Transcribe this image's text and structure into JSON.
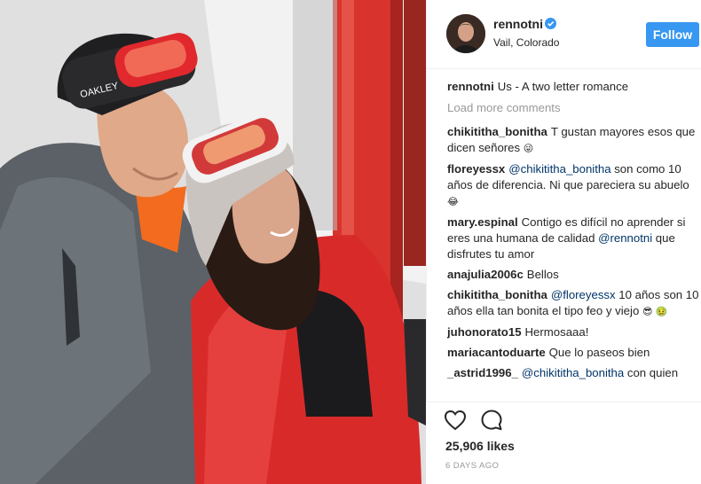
{
  "post": {
    "username": "rennotni",
    "location": "Vail, Colorado",
    "follow_label": "Follow",
    "caption": {
      "user": "rennotni",
      "text": "Us - A two letter romance"
    },
    "load_more_label": "Load more comments",
    "likes": "25,906 likes",
    "timestamp": "6 DAYS AGO"
  },
  "comments": [
    {
      "user": "chikititha_bonitha",
      "pre": "T gustan mayores esos que dicen señores",
      "mention": "",
      "post": "",
      "emoji": "😜"
    },
    {
      "user": "floreyessx",
      "pre": "",
      "mention": "@chikititha_bonitha",
      "post": " son como 10 años de diferencia. Ni que pareciera su abuelo",
      "emoji": "😂"
    },
    {
      "user": "mary.espinal",
      "pre": "Contigo es difícil no aprender si eres una humana de calidad ",
      "mention": "@rennotni",
      "post": " que disfrutes tu amor",
      "emoji": ""
    },
    {
      "user": "anajulia2006c",
      "pre": "Bellos",
      "mention": "",
      "post": "",
      "emoji": ""
    },
    {
      "user": "chikititha_bonitha",
      "pre": "",
      "mention": "@floreyessx",
      "post": " 10 años son 10 años ella tan bonita el tipo feo y viejo",
      "emoji": "😎 🤢"
    },
    {
      "user": "juhonorato15",
      "pre": "Hermosaaa!",
      "mention": "",
      "post": "",
      "emoji": ""
    },
    {
      "user": "mariacantoduarte",
      "pre": "Que lo paseos bien",
      "mention": "",
      "post": "",
      "emoji": ""
    },
    {
      "user": "_astrid1996_",
      "pre": "",
      "mention": "@chikititha_bonitha",
      "post": " con quien",
      "emoji": ""
    }
  ],
  "icons": {
    "like": "heart-icon",
    "comment": "comment-bubble-icon",
    "verified": "verified-badge-icon"
  },
  "colors": {
    "follow_button": "#3897f0",
    "verified": "#3897f0",
    "mention": "#003569",
    "muted": "#999999"
  }
}
